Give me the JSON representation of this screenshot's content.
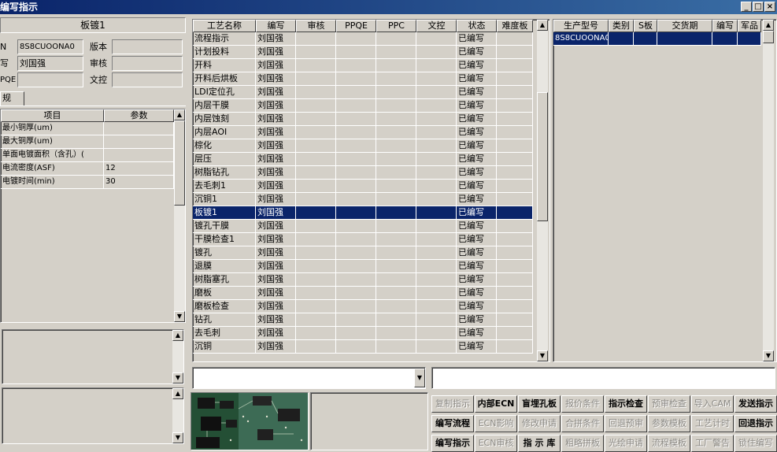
{
  "window": {
    "title": "编写指示",
    "min_glyph": "_",
    "max_glyph": "□",
    "close_glyph": "×"
  },
  "left_panel": {
    "header": "板镀1",
    "fields": [
      {
        "label": "N",
        "value": "8S8CUOONA0"
      },
      {
        "label": "写",
        "value": "刘国强"
      },
      {
        "label": "PQE",
        "value": ""
      }
    ],
    "side_fields": [
      {
        "label": "版本",
        "value": ""
      },
      {
        "label": "审核",
        "value": ""
      },
      {
        "label": "文控",
        "value": ""
      }
    ],
    "tab_label": "规",
    "param_table": {
      "columns": [
        "项目",
        "参数"
      ],
      "rows": [
        [
          "最小铜厚(um)",
          ""
        ],
        [
          "最大铜厚(um)",
          ""
        ],
        [
          "单面电镀面积（含孔）(",
          ""
        ],
        [
          "电流密度(ASF)",
          "12"
        ],
        [
          "电镀时间(min)",
          "30"
        ]
      ]
    }
  },
  "process_table": {
    "columns": [
      "工艺名称",
      "编写",
      "审核",
      "PPQE",
      "PPC",
      "文控",
      "状态",
      "难度板"
    ],
    "selected_index": 13,
    "rows": [
      [
        "流程指示",
        "刘国强",
        "",
        "",
        "",
        "",
        "已编写",
        ""
      ],
      [
        "计划投料",
        "刘国强",
        "",
        "",
        "",
        "",
        "已编写",
        ""
      ],
      [
        "开料",
        "刘国强",
        "",
        "",
        "",
        "",
        "已编写",
        ""
      ],
      [
        "开料后烘板",
        "刘国强",
        "",
        "",
        "",
        "",
        "已编写",
        ""
      ],
      [
        "LDI定位孔",
        "刘国强",
        "",
        "",
        "",
        "",
        "已编写",
        ""
      ],
      [
        "内层干膜",
        "刘国强",
        "",
        "",
        "",
        "",
        "已编写",
        ""
      ],
      [
        "内层蚀刻",
        "刘国强",
        "",
        "",
        "",
        "",
        "已编写",
        ""
      ],
      [
        "内层AOI",
        "刘国强",
        "",
        "",
        "",
        "",
        "已编写",
        ""
      ],
      [
        "棕化",
        "刘国强",
        "",
        "",
        "",
        "",
        "已编写",
        ""
      ],
      [
        "层压",
        "刘国强",
        "",
        "",
        "",
        "",
        "已编写",
        ""
      ],
      [
        "树脂钻孔",
        "刘国强",
        "",
        "",
        "",
        "",
        "已编写",
        ""
      ],
      [
        "去毛刺1",
        "刘国强",
        "",
        "",
        "",
        "",
        "已编写",
        ""
      ],
      [
        "沉铜1",
        "刘国强",
        "",
        "",
        "",
        "",
        "已编写",
        ""
      ],
      [
        "板镀1",
        "刘国强",
        "",
        "",
        "",
        "",
        "已编写",
        ""
      ],
      [
        "镀孔干膜",
        "刘国强",
        "",
        "",
        "",
        "",
        "已编写",
        ""
      ],
      [
        "干膜检查1",
        "刘国强",
        "",
        "",
        "",
        "",
        "已编写",
        ""
      ],
      [
        "镀孔",
        "刘国强",
        "",
        "",
        "",
        "",
        "已编写",
        ""
      ],
      [
        "退膜",
        "刘国强",
        "",
        "",
        "",
        "",
        "已编写",
        ""
      ],
      [
        "树脂塞孔",
        "刘国强",
        "",
        "",
        "",
        "",
        "已编写",
        ""
      ],
      [
        "磨板",
        "刘国强",
        "",
        "",
        "",
        "",
        "已编写",
        ""
      ],
      [
        "磨板检查",
        "刘国强",
        "",
        "",
        "",
        "",
        "已编写",
        ""
      ],
      [
        "钻孔",
        "刘国强",
        "",
        "",
        "",
        "",
        "已编写",
        ""
      ],
      [
        "去毛刺",
        "刘国强",
        "",
        "",
        "",
        "",
        "已编写",
        ""
      ],
      [
        "沉铜",
        "刘国强",
        "",
        "",
        "",
        "",
        "已编写",
        ""
      ]
    ]
  },
  "product_table": {
    "columns": [
      "生产型号",
      "类别",
      "S板",
      "交货期",
      "编写",
      "军品"
    ],
    "rows": [
      [
        "8S8CUOONA0",
        "",
        "",
        "",
        "",
        ""
      ]
    ]
  },
  "buttons": [
    [
      "复制指示",
      "内部ECN",
      "盲埋孔板",
      "报价条件",
      "指示检查",
      "预审检查",
      "导入CAM",
      "发送指示"
    ],
    [
      "编写流程",
      "ECN影响",
      "修改申请",
      "合拼条件",
      "回退预审",
      "参数模板",
      "工艺计时",
      "回退指示"
    ],
    [
      "编写指示",
      "ECN审核",
      "指 示 库",
      "粗略拼板",
      "光绘申请",
      "流程模板",
      "工厂警告",
      "锁住编写"
    ]
  ],
  "button_enabled": [
    [
      false,
      true,
      true,
      false,
      true,
      false,
      false,
      true
    ],
    [
      true,
      false,
      false,
      false,
      false,
      false,
      false,
      true
    ],
    [
      true,
      false,
      true,
      false,
      false,
      false,
      false,
      false
    ]
  ],
  "combo": {
    "value": ""
  },
  "colors": {
    "selection": "#0a246a",
    "face": "#d4d0c8"
  }
}
